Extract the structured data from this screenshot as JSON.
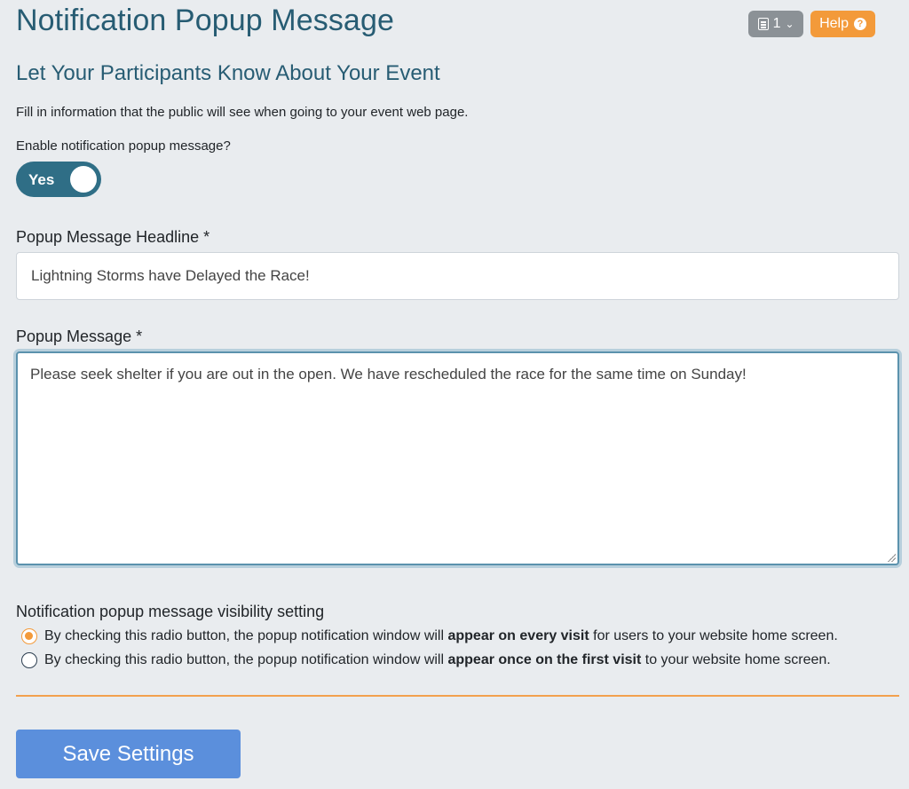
{
  "header": {
    "title": "Notification Popup Message",
    "page_select_value": "1",
    "page_select_icon": "document-list-icon",
    "help_label": "Help",
    "help_icon": "question-circle-icon"
  },
  "section": {
    "title": "Let Your Participants Know About Your Event",
    "intro": "Fill in information that the public will see when going to your event web page."
  },
  "enable": {
    "label": "Enable notification popup message?",
    "toggle_label": "Yes",
    "toggle_on": true
  },
  "headline": {
    "label": "Popup Message Headline *",
    "value": "Lightning Storms have Delayed the Race!"
  },
  "message": {
    "label": "Popup Message *",
    "value": "Please seek shelter if you are out in the open.  We have rescheduled the race for the same time on Sunday!"
  },
  "visibility": {
    "label": "Notification popup message visibility setting",
    "options": [
      {
        "prefix": "By checking this radio button, the popup notification window will ",
        "bold": "appear on every visit",
        "suffix": " for users to your website home screen.",
        "checked": true
      },
      {
        "prefix": "By checking this radio button, the popup notification window will ",
        "bold": "appear once on the first visit",
        "suffix": " to your website home screen.",
        "checked": false
      }
    ]
  },
  "actions": {
    "save_label": "Save Settings"
  },
  "colors": {
    "title": "#275c73",
    "accent_orange": "#f39a3a",
    "toggle_on": "#2f6e86",
    "save_button": "#5b8fdc",
    "background": "#e9ecef"
  }
}
